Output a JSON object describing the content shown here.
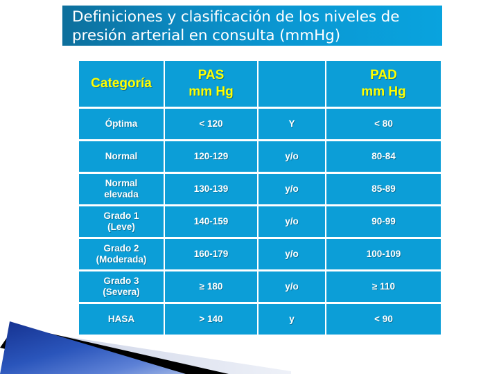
{
  "slide": {
    "title_line1": "Definiciones y clasificación de los niveles de",
    "title_line2": "presión arterial en consulta (mmHg)",
    "title_full": "Definiciones y clasificación de los niveles de\npresión arterial en consulta (mmHg)"
  },
  "colors": {
    "cell_blue": "#0c9ed7",
    "header_text": "#ffff00",
    "data_text": "#ffffff",
    "title_gradient_left": "#0d6f9c",
    "title_gradient_right": "#09a3de",
    "decoration_blue_dark": "#1b3f9e",
    "decoration_blue_light": "#7f9ede",
    "decoration_black": "#000000",
    "decoration_gray": "#d8dce9"
  },
  "table": {
    "headers": [
      "Categoría",
      "PAS\nmm Hg",
      "",
      "PAD\nmm Hg"
    ],
    "rows": [
      {
        "categoria": "Óptima",
        "pas": "< 120",
        "conjuncion": "Y",
        "pad": "< 80"
      },
      {
        "categoria": "Normal",
        "pas": "120-129",
        "conjuncion": "y/o",
        "pad": "80-84"
      },
      {
        "categoria": "Normal\nelevada",
        "pas": "130-139",
        "conjuncion": "y/o",
        "pad": "85-89"
      },
      {
        "categoria": "Grado 1\n(Leve)",
        "pas": "140-159",
        "conjuncion": "y/o",
        "pad": "90-99"
      },
      {
        "categoria": "Grado 2\n(Moderada)",
        "pas": "160-179",
        "conjuncion": "y/o",
        "pad": "100-109"
      },
      {
        "categoria": "Grado 3\n(Severa)",
        "pas": "≥ 180",
        "conjuncion": "y/o",
        "pad": "≥ 110"
      },
      {
        "categoria": "HASA",
        "pas": "> 140",
        "conjuncion": "y",
        "pad": "< 90"
      }
    ]
  }
}
